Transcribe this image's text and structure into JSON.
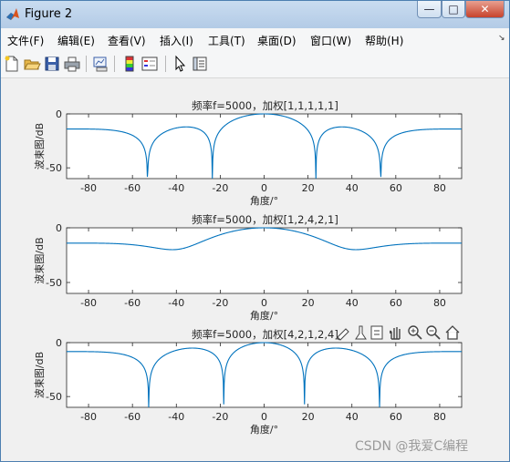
{
  "window": {
    "title": "Figure 2",
    "controls": {
      "minimize": "—",
      "maximize": "□",
      "close": "✕"
    }
  },
  "menubar": {
    "items": [
      "文件(F)",
      "编辑(E)",
      "查看(V)",
      "插入(I)",
      "工具(T)",
      "桌面(D)",
      "窗口(W)",
      "帮助(H)"
    ],
    "pin": "↘"
  },
  "toolbar": {
    "icons": [
      "new-figure-icon",
      "open-file-icon",
      "save-icon",
      "print-icon",
      "link-plot-icon",
      "colorbar-icon",
      "legend-icon",
      "pointer-icon",
      "property-editor-icon"
    ]
  },
  "axes_toolbar": {
    "icons": [
      "brush-icon",
      "data-tips-icon",
      "export-icon",
      "pan-icon",
      "zoom-in-icon",
      "zoom-out-icon",
      "home-icon"
    ]
  },
  "watermark": "CSDN @我爱C编程",
  "chart_data": [
    {
      "type": "line",
      "title": "频率f=5000，加权[1,1,1,1,1]",
      "xlabel": "角度/°",
      "ylabel": "波束图/dB",
      "xlim": [
        -90,
        90
      ],
      "ylim": [
        -60,
        0
      ],
      "xticks": [
        -80,
        -60,
        -40,
        -20,
        0,
        20,
        40,
        60,
        80
      ],
      "yticks": [
        0,
        -50
      ],
      "weights": [
        1,
        1,
        1,
        1,
        1
      ],
      "series": [
        {
          "color": "#0072BD"
        }
      ]
    },
    {
      "type": "line",
      "title": "频率f=5000，加权[1,2,4,2,1]",
      "xlabel": "角度/°",
      "ylabel": "波束图/dB",
      "xlim": [
        -90,
        90
      ],
      "ylim": [
        -60,
        0
      ],
      "xticks": [
        -80,
        -60,
        -40,
        -20,
        0,
        20,
        40,
        60,
        80
      ],
      "yticks": [
        0,
        -50
      ],
      "weights": [
        1,
        2,
        4,
        2,
        1
      ],
      "series": [
        {
          "color": "#0072BD"
        }
      ]
    },
    {
      "type": "line",
      "title": "频率f=5000，加权[4,2,1,2,4]",
      "xlabel": "角度/°",
      "ylabel": "波束图/dB",
      "xlim": [
        -90,
        90
      ],
      "ylim": [
        -60,
        0
      ],
      "xticks": [
        -80,
        -60,
        -40,
        -20,
        0,
        20,
        40,
        60,
        80
      ],
      "yticks": [
        0,
        -50
      ],
      "weights": [
        4,
        2,
        1,
        2,
        4
      ],
      "series": [
        {
          "color": "#0072BD"
        }
      ]
    }
  ]
}
